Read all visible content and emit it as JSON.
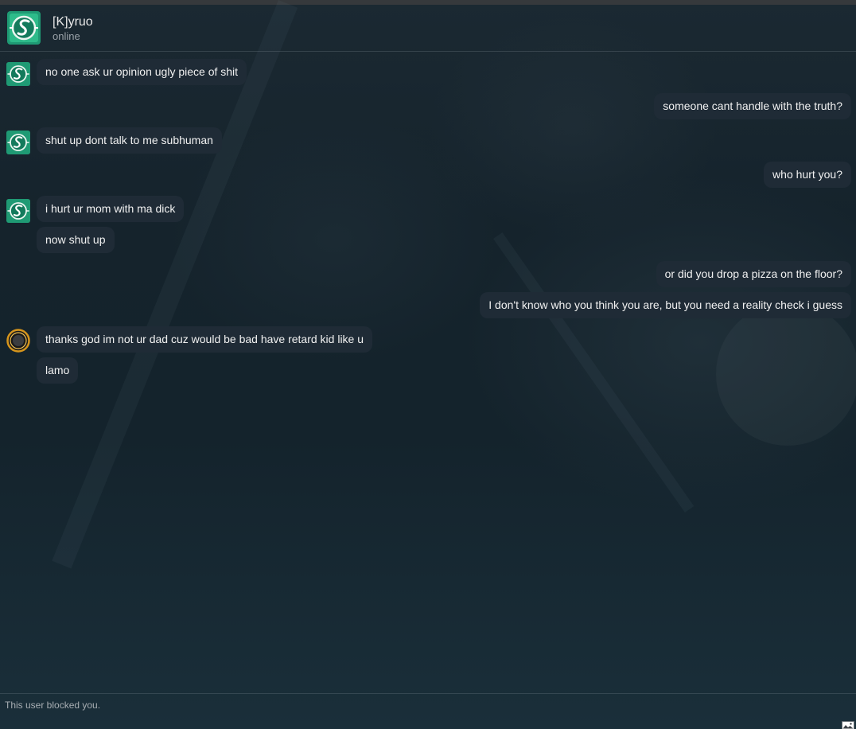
{
  "header": {
    "name": "[K]yruo",
    "status": "online"
  },
  "messages": [
    {
      "side": "left",
      "text": "no one ask ur opinion ugly piece of shit"
    },
    {
      "side": "right",
      "text": "someone cant handle with the truth?"
    },
    {
      "side": "left",
      "text": "shut up dont talk to me subhuman"
    },
    {
      "side": "right",
      "text": "who hurt you?"
    },
    {
      "side": "left",
      "text": "i hurt ur mom with ma dick"
    },
    {
      "side": "left",
      "text": "now shut up"
    },
    {
      "side": "right",
      "text": "or did you drop a pizza on the floor?"
    },
    {
      "side": "right",
      "text": "I don't know who you think you are, but you need a reality check i guess"
    },
    {
      "side": "left",
      "text": "thanks god im not ur dad cuz would be bad have retard kid like u"
    },
    {
      "side": "left",
      "text": "lamo"
    }
  ],
  "footer": {
    "notice": "This user blocked you."
  },
  "icons": {
    "contact_avatar": "summoner-emblem-icon",
    "self_avatar": "ring-emblem-icon",
    "image": "image-icon"
  },
  "colors": {
    "bubble": "#1f2b36",
    "emblem_green": "#1f9a74",
    "self_ring": "#d6951c"
  }
}
